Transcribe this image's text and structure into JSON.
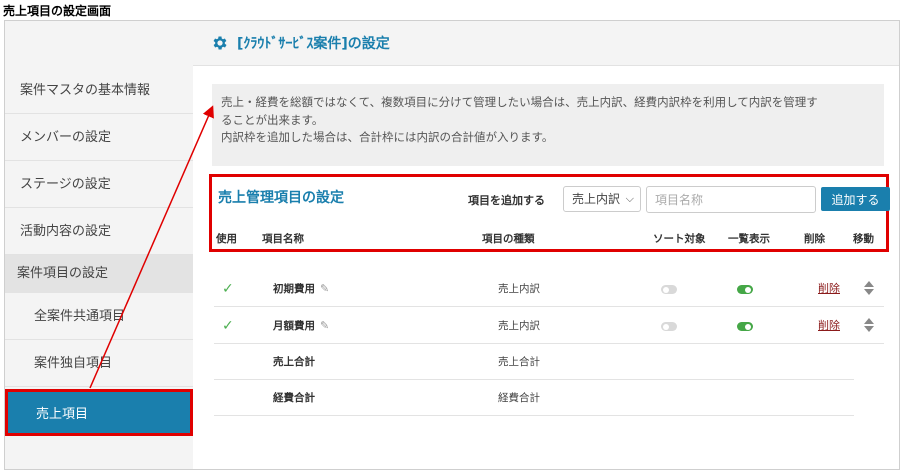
{
  "page_caption": "売上項目の設定画面",
  "sidebar": {
    "items": [
      {
        "label": "案件マスタの基本情報"
      },
      {
        "label": "メンバーの設定"
      },
      {
        "label": "ステージの設定"
      },
      {
        "label": "活動内容の設定"
      }
    ],
    "section_label": "案件項目の設定",
    "sub_items": [
      {
        "label": "全案件共通項目"
      },
      {
        "label": "案件独自項目"
      }
    ],
    "active_item": "売上項目"
  },
  "header": {
    "title": "[ｸﾗｳﾄﾞｻｰﾋﾞｽ案件]の設定",
    "icon": "gear-icon"
  },
  "info": {
    "line1": "売上・経費を総額ではなくて、複数項目に分けて管理したい場合は、売上内訳、経費内訳枠を利用して内訳を管理す",
    "line2": "ることが出来ます。",
    "line3": "内訳枠を追加した場合は、合計枠には内訳の合計値が入ります。"
  },
  "section": {
    "title": "売上管理項目の設定",
    "add_label": "項目を追加する",
    "select_value": "売上内訳",
    "input_placeholder": "項目名称",
    "add_button": "追加する"
  },
  "columns": {
    "use": "使用",
    "name": "項目名称",
    "type": "項目の種類",
    "sort": "ソート対象",
    "list": "一覧表示",
    "delete": "削除",
    "move": "移動"
  },
  "rows": [
    {
      "name": "初期費用",
      "type": "売上内訳",
      "used": true,
      "sort_on": false,
      "list_on": true,
      "delete_label": "削除",
      "editable": true
    },
    {
      "name": "月額費用",
      "type": "売上内訳",
      "used": true,
      "sort_on": false,
      "list_on": true,
      "delete_label": "削除",
      "editable": true
    },
    {
      "name": "売上合計",
      "type": "売上合計",
      "used": false,
      "editable": false
    },
    {
      "name": "経費合計",
      "type": "経費合計",
      "used": false,
      "editable": false
    }
  ],
  "colors": {
    "accent": "#1a7fad",
    "highlight": "#e00000",
    "toggle_on": "#45a747",
    "delete_link": "#8b1a1a"
  }
}
